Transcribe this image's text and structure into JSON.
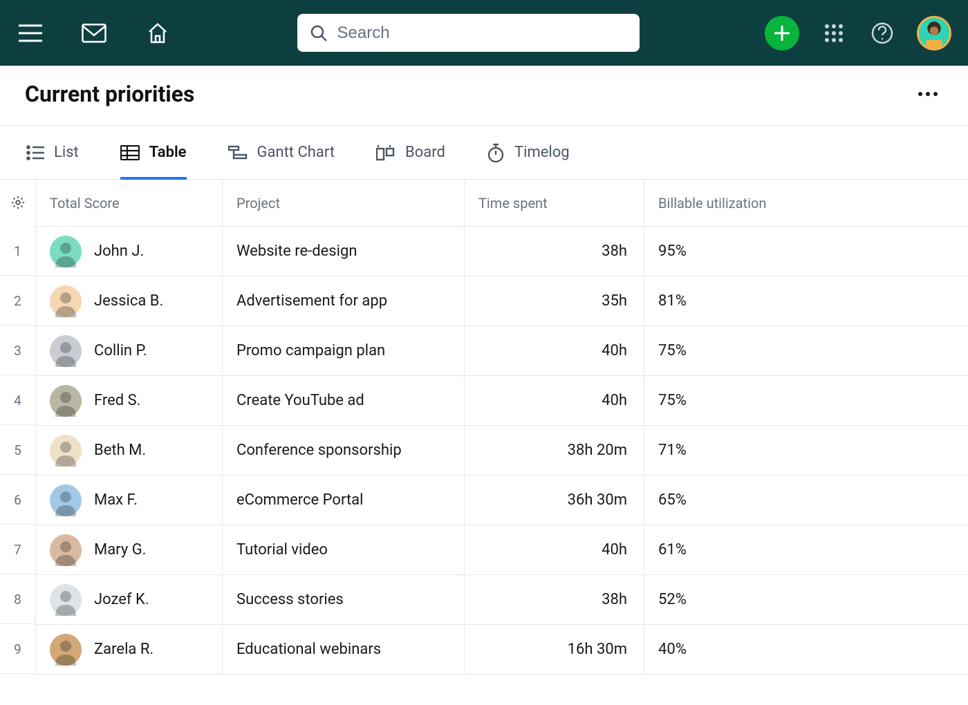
{
  "header": {
    "search_placeholder": "Search"
  },
  "page": {
    "title": "Current priorities"
  },
  "tabs": {
    "list": "List",
    "table": "Table",
    "gantt": "Gantt Chart",
    "board": "Board",
    "timelog": "Timelog"
  },
  "columns": {
    "score": "Total Score",
    "project": "Project",
    "time": "Time spent",
    "util": "Billable utilization"
  },
  "rows": [
    {
      "idx": "1",
      "name": "John J.",
      "project": "Website re-design",
      "time": "38h",
      "pct": "95%",
      "fill": 95,
      "color": "green",
      "avatar_bg": "#7bdcc2"
    },
    {
      "idx": "2",
      "name": "Jessica B.",
      "project": "Advertisement for app",
      "time": "35h",
      "pct": "81%",
      "fill": 81,
      "color": "green",
      "avatar_bg": "#f5d7b2"
    },
    {
      "idx": "3",
      "name": "Collin P.",
      "project": "Promo campaign plan",
      "time": "40h",
      "pct": "75%",
      "fill": 75,
      "color": "green",
      "avatar_bg": "#c9cdd3"
    },
    {
      "idx": "4",
      "name": "Fred S.",
      "project": "Create YouTube ad",
      "time": "40h",
      "pct": "75%",
      "fill": 75,
      "color": "green",
      "avatar_bg": "#b9b7a3"
    },
    {
      "idx": "5",
      "name": "Beth M.",
      "project": "Conference sponsorship",
      "time": "38h 20m",
      "pct": "71%",
      "fill": 71,
      "color": "green",
      "avatar_bg": "#efe1c8"
    },
    {
      "idx": "6",
      "name": "Max F.",
      "project": "eCommerce Portal",
      "time": "36h 30m",
      "pct": "65%",
      "fill": 65,
      "color": "amber",
      "avatar_bg": "#a3c8e6"
    },
    {
      "idx": "7",
      "name": "Mary G.",
      "project": "Tutorial video",
      "time": "40h",
      "pct": "61%",
      "fill": 61,
      "color": "amber",
      "avatar_bg": "#d9b9a0"
    },
    {
      "idx": "8",
      "name": "Jozef K.",
      "project": "Success stories",
      "time": "38h",
      "pct": "52%",
      "fill": 52,
      "color": "amber",
      "avatar_bg": "#dfe3e6"
    },
    {
      "idx": "9",
      "name": "Zarela R.",
      "project": "Educational webinars",
      "time": "16h 30m",
      "pct": "40%",
      "fill": 40,
      "color": "red",
      "avatar_bg": "#d1a876"
    }
  ]
}
